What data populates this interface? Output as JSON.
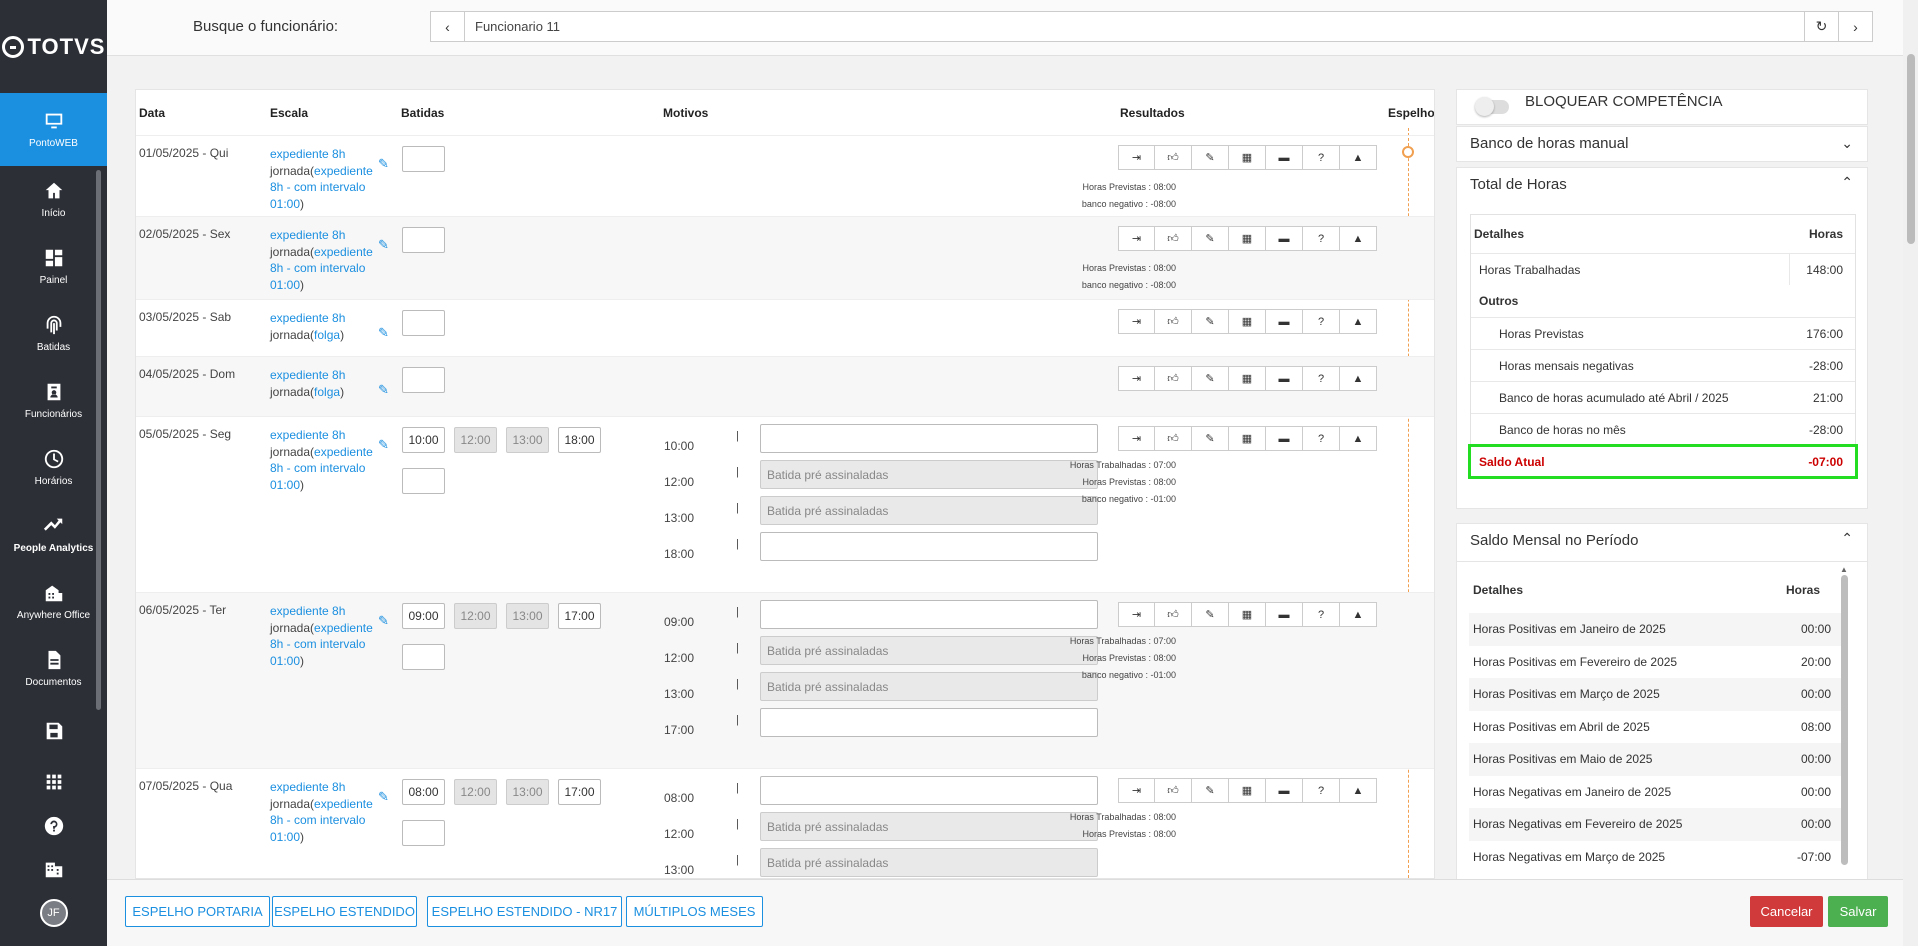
{
  "sidebar": {
    "logo": "TOTVS",
    "items": [
      {
        "label": "PontoWEB",
        "icon": "monitor-icon"
      },
      {
        "label": "Início",
        "icon": "home-icon"
      },
      {
        "label": "Painel",
        "icon": "dashboard-icon"
      },
      {
        "label": "Batidas",
        "icon": "fingerprint-icon"
      },
      {
        "label": "Funcionários",
        "icon": "badge-icon"
      },
      {
        "label": "Horários",
        "icon": "clock-icon"
      },
      {
        "label": "People Analytics",
        "icon": "trend-icon"
      },
      {
        "label": "Anywhere Office",
        "icon": "building-icon"
      },
      {
        "label": "Documentos",
        "icon": "document-icon"
      }
    ],
    "avatar": "JF"
  },
  "topbar": {
    "search_label": "Busque o funcionário:",
    "search_value": "Funcionario 11"
  },
  "table": {
    "headers": {
      "data": "Data",
      "escala": "Escala",
      "batidas": "Batidas",
      "motivos": "Motivos",
      "resultados": "Resultados",
      "espelho": "Espelho"
    },
    "escala_link": "expediente 8h",
    "jornada_prefix": "jornada(",
    "jornada_suffix": ")",
    "jornada_expediente_a": "expediente",
    "jornada_expediente_b": "8h - com intervalo 01:00",
    "jornada_folga": "folga",
    "motivo_placeholder": "Batida pré assinaladas",
    "rows": [
      {
        "date": "01/05/2025 - Qui",
        "res1": "Horas Previstas : 08:00",
        "res2": "banco negativo : -08:00"
      },
      {
        "date": "02/05/2025 - Sex",
        "res1": "Horas Previstas : 08:00",
        "res2": "banco negativo : -08:00"
      },
      {
        "date": "03/05/2025 - Sab"
      },
      {
        "date": "04/05/2025 - Dom"
      },
      {
        "date": "05/05/2025 - Seg",
        "b1": "10:00",
        "b2": "12:00",
        "b3": "13:00",
        "b4": "18:00",
        "t1": "10:00",
        "t2": "12:00",
        "t3": "13:00",
        "t4": "18:00",
        "res0": "Horas Trabalhadas : 07:00",
        "res1": "Horas Previstas : 08:00",
        "res2": "banco negativo : -01:00"
      },
      {
        "date": "06/05/2025 - Ter",
        "b1": "09:00",
        "b2": "12:00",
        "b3": "13:00",
        "b4": "17:00",
        "t1": "09:00",
        "t2": "12:00",
        "t3": "13:00",
        "t4": "17:00",
        "res0": "Horas Trabalhadas : 07:00",
        "res1": "Horas Previstas : 08:00",
        "res2": "banco negativo : -01:00"
      },
      {
        "date": "07/05/2025 - Qua",
        "b1": "08:00",
        "b2": "12:00",
        "b3": "13:00",
        "b4": "17:00",
        "t1": "08:00",
        "t2": "12:00",
        "t3": "13:00",
        "res0": "Horas Trabalhadas : 08:00",
        "res1": "Horas Previstas : 08:00"
      }
    ]
  },
  "right": {
    "bloquear": "BLOQUEAR COMPETÊNCIA",
    "banco_manual": "Banco de horas manual",
    "total_horas": {
      "title": "Total de Horas",
      "col1": "Detalhes",
      "col2": "Horas",
      "trabalhadas_label": "Horas Trabalhadas",
      "trabalhadas_value": "148:00",
      "outros": "Outros",
      "previstas_label": "Horas Previstas",
      "previstas_value": "176:00",
      "negativas_label": "Horas mensais negativas",
      "negativas_value": "-28:00",
      "acumulado_label": "Banco de horas acumulado até Abril / 2025",
      "acumulado_value": "21:00",
      "mes_label": "Banco de horas no mês",
      "mes_value": "-28:00",
      "saldo_label": "Saldo Atual",
      "saldo_value": "-07:00"
    },
    "saldo_mensal": {
      "title": "Saldo Mensal no Período",
      "col1": "Detalhes",
      "col2": "Horas",
      "rows": [
        {
          "label": "Horas Positivas em Janeiro de 2025",
          "value": "00:00"
        },
        {
          "label": "Horas Positivas em Fevereiro de 2025",
          "value": "20:00"
        },
        {
          "label": "Horas Positivas em Março de 2025",
          "value": "00:00"
        },
        {
          "label": "Horas Positivas em Abril de 2025",
          "value": "08:00"
        },
        {
          "label": "Horas Positivas em Maio de 2025",
          "value": "00:00"
        },
        {
          "label": "Horas Negativas em Janeiro de 2025",
          "value": "00:00"
        },
        {
          "label": "Horas Negativas em Fevereiro de 2025",
          "value": "00:00"
        },
        {
          "label": "Horas Negativas em Março de 2025",
          "value": "-07:00"
        }
      ]
    }
  },
  "footer": {
    "espelho_portaria": "ESPELHO PORTARIA",
    "espelho_estendido": "ESPELHO ESTENDIDO",
    "espelho_nr17": "ESPELHO ESTENDIDO - NR17",
    "multiplos_meses": "MÚLTIPLOS MESES",
    "cancelar": "Cancelar",
    "salvar": "Salvar"
  },
  "colors": {
    "accent": "#1b8fe0",
    "cancel": "#d03a3a",
    "save": "#4caf50",
    "highlight": "#22dd22",
    "saldo": "#cc0000"
  }
}
